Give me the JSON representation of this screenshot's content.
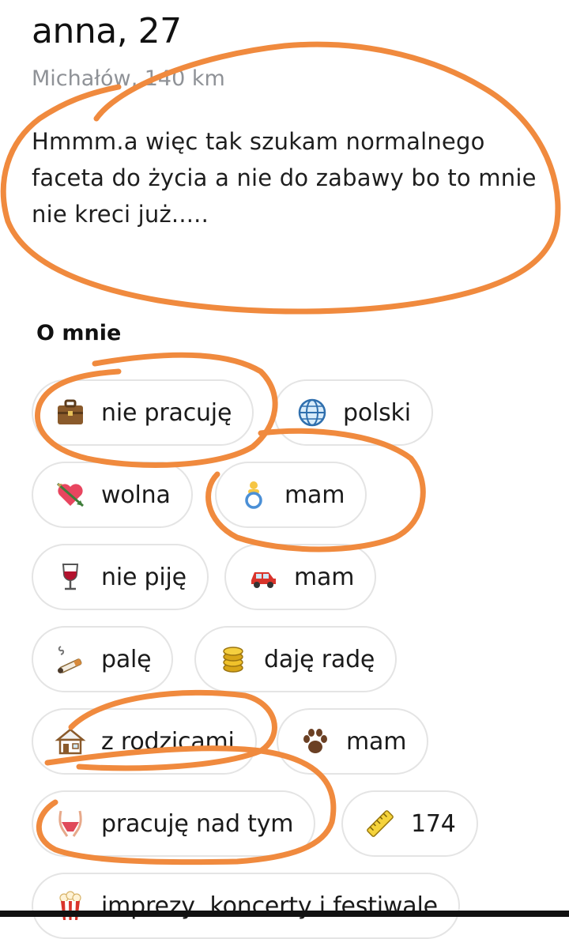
{
  "profile": {
    "name_age": "anna, 27",
    "location": "Michałów, 140 km",
    "bio": "Hmmm.a więc tak szukam normalnego faceta do życia a nie do zabawy bo to mnie nie kreci już....."
  },
  "about": {
    "title": "O mnie",
    "chips": [
      {
        "icon": "briefcase-icon",
        "label": "nie pracuję"
      },
      {
        "icon": "globe-icon",
        "label": "polski"
      },
      {
        "icon": "heart-arrow-icon",
        "label": "wolna"
      },
      {
        "icon": "pacifier-icon",
        "label": "mam"
      },
      {
        "icon": "wine-glass-icon",
        "label": "nie piję"
      },
      {
        "icon": "car-icon",
        "label": "mam"
      },
      {
        "icon": "cigarette-icon",
        "label": "palę"
      },
      {
        "icon": "coins-icon",
        "label": "daję radę"
      },
      {
        "icon": "house-icon",
        "label": "z rodzicami"
      },
      {
        "icon": "paw-icon",
        "label": "mam"
      },
      {
        "icon": "hips-icon",
        "label": "pracuję nad tym"
      },
      {
        "icon": "ruler-icon",
        "label": "174"
      },
      {
        "icon": "popcorn-icon",
        "label": "imprezy, koncerty i festiwale"
      }
    ]
  },
  "colors": {
    "annotation": "#f08a3e",
    "chip_border": "#e4e4e4",
    "muted_text": "#8f9297"
  }
}
